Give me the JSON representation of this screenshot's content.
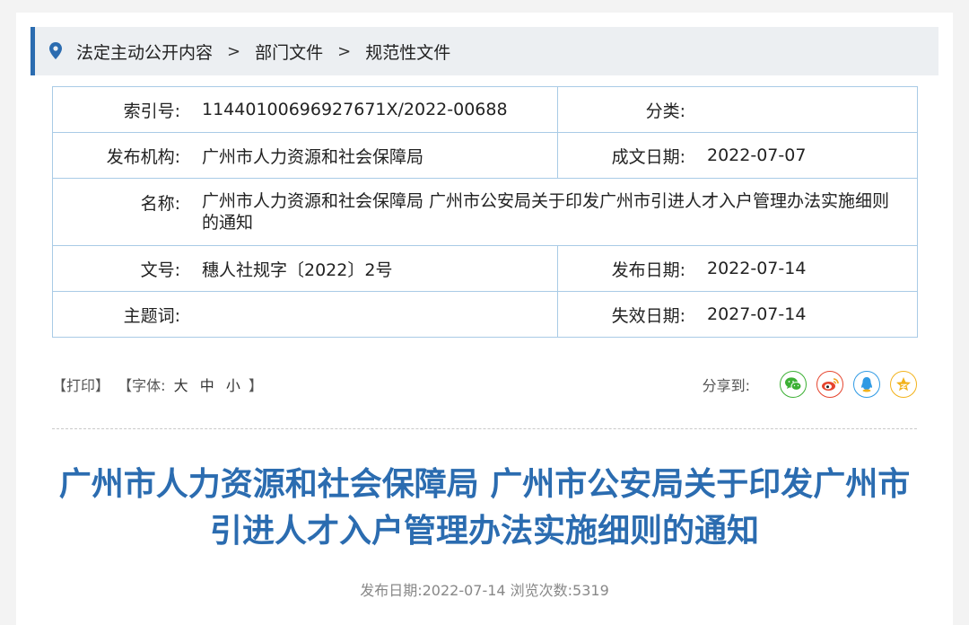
{
  "breadcrumb": {
    "items": [
      "法定主动公开内容",
      "部门文件",
      "规范性文件"
    ],
    "separator": ">"
  },
  "meta": {
    "index_label": "索引号:",
    "index_value": "11440100696927671X/2022-00688",
    "category_label": "分类:",
    "category_value": "",
    "org_label": "发布机构:",
    "org_value": "广州市人力资源和社会保障局",
    "written_label": "成文日期:",
    "written_value": "2022-07-07",
    "name_label": "名称:",
    "name_value": "广州市人力资源和社会保障局 广州市公安局关于印发广州市引进人才入户管理办法实施细则的通知",
    "docno_label": "文号:",
    "docno_value": "穗人社规字〔2022〕2号",
    "published_label": "发布日期:",
    "published_value": "2022-07-14",
    "keywords_label": "主题词:",
    "keywords_value": "",
    "expire_label": "失效日期:",
    "expire_value": "2027-07-14"
  },
  "tools": {
    "print": "【打印】",
    "font_prefix": "【字体:",
    "font_large": "大",
    "font_medium": "中",
    "font_small": "小",
    "font_suffix": "】",
    "share_label": "分享到:"
  },
  "share_icons": [
    {
      "name": "wechat-icon",
      "color": "#3cb034"
    },
    {
      "name": "weibo-icon",
      "color": "#e6452e"
    },
    {
      "name": "qq-icon",
      "color": "#2f9ae4"
    },
    {
      "name": "qzone-icon",
      "color": "#f2b21b"
    }
  ],
  "article": {
    "title": "广州市人力资源和社会保障局 广州市公安局关于印发广州市引进人才入户管理办法实施细则的通知",
    "info": "发布日期:2022-07-14  浏览次数:5319"
  },
  "colors": {
    "accent": "#2b6cb0",
    "table_border": "#a9cbe6",
    "breadcrumb_bg": "#eceff2"
  }
}
